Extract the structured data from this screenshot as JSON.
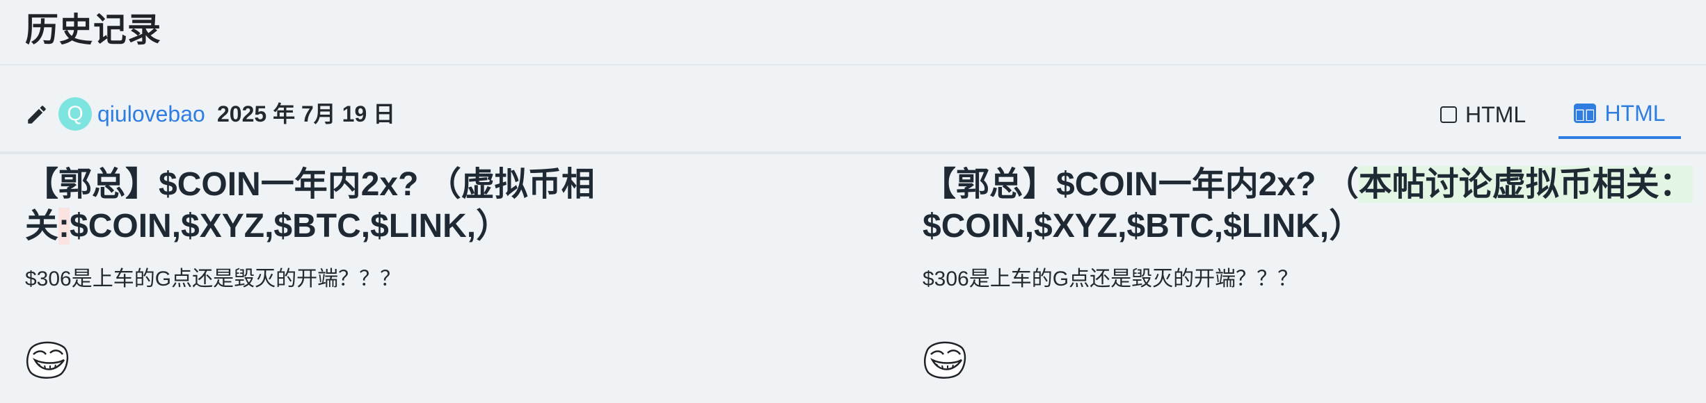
{
  "header": {
    "title": "历史记录"
  },
  "revision": {
    "editor_initial": "Q",
    "username": "qiulovebao",
    "date": "2025 年 7月 19 日"
  },
  "view_toggle": {
    "inline_label": "HTML",
    "split_label": "HTML",
    "active": "split"
  },
  "diff": {
    "left": {
      "title_part1": "【郭总】$COIN一年内2x? （虚拟币相关",
      "title_removed": ":",
      "title_part2": "$COIN,$XYZ,$BTC,$LINK,）",
      "body": "$306是上车的G点还是毁灭的开端？？？"
    },
    "right": {
      "title_part1": "【郭总】$COIN一年内2x? （",
      "title_added": "本帖讨论虚拟币相关：",
      "title_part2": "$COIN,$XYZ,$BTC,$LINK,）",
      "body": "$306是上车的G点还是毁灭的开端？？？"
    }
  },
  "colors": {
    "accent": "#2f7de1",
    "avatar_bg": "#7ee4df",
    "removed_bg": "#fbe3e1",
    "added_bg": "#e3f6e3",
    "background": "#eff3f6"
  }
}
